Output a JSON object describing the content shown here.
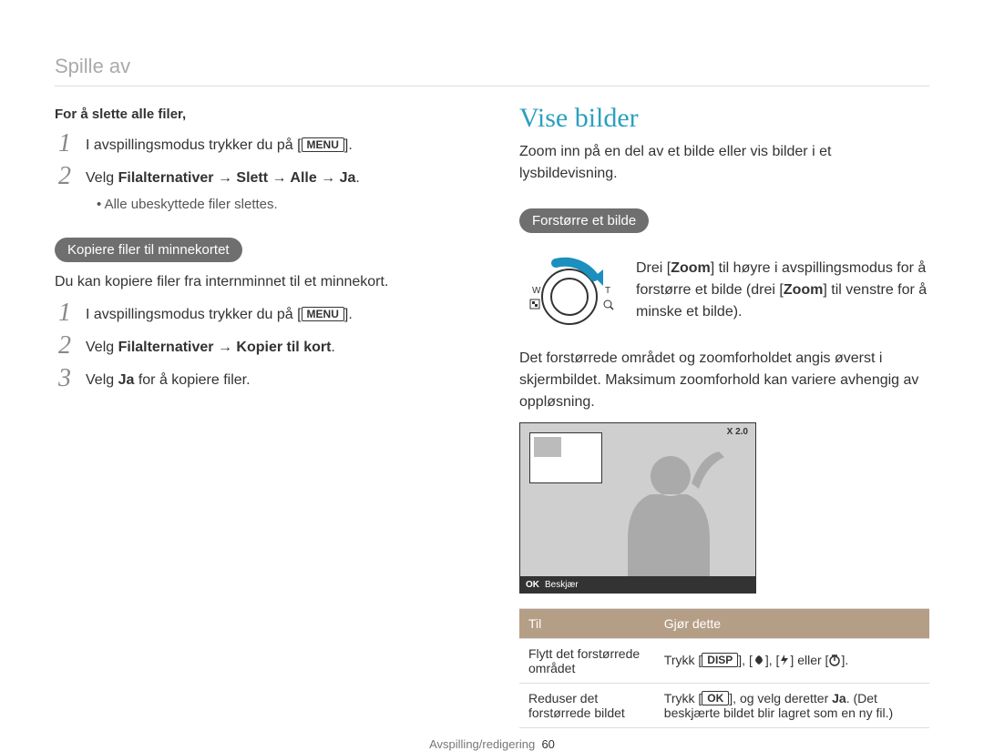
{
  "header": "Spille av",
  "left": {
    "delete_title": "For å slette alle filer,",
    "delete_steps": [
      {
        "num": "1",
        "pre": "I avspillingsmodus trykker du på [",
        "btn": "MENU",
        "post": "]."
      },
      {
        "num": "2",
        "pre": "Velg ",
        "bold": "Filalternativer → Slett → Alle → Ja",
        "post": "."
      }
    ],
    "delete_bullet": "Alle ubeskyttede filer slettes.",
    "copy_pill": "Kopiere filer til minnekortet",
    "copy_desc": "Du kan kopiere filer fra internminnet til et minnekort.",
    "copy_steps": [
      {
        "num": "1",
        "pre": "I avspillingsmodus trykker du på [",
        "btn": "MENU",
        "post": "]."
      },
      {
        "num": "2",
        "pre": "Velg ",
        "bold": "Filalternativer → Kopier til kort",
        "post": "."
      },
      {
        "num": "3",
        "pre": "Velg ",
        "bold": "Ja",
        "post": " for å kopiere filer."
      }
    ]
  },
  "right": {
    "title": "Vise bilder",
    "intro": "Zoom inn på en del av et bilde eller vis bilder i et lysbildevisning.",
    "enlarge_pill": "Forstørre et bilde",
    "zoom_text_parts": {
      "p1": "Drei [",
      "z1": "Zoom",
      "p2": "] til høyre i avspillingsmodus for å forstørre et bilde (drei [",
      "z2": "Zoom",
      "p3": "] til venstre for å minske et bilde)."
    },
    "zoom_note": "Det forstørrede området og zoomforholdet angis øverst i skjermbildet. Maksimum zoomforhold kan variere avhengig av oppløsning.",
    "zoom_label": "X 2.0",
    "zoom_ok": "Beskjær",
    "dial_labels": {
      "w": "W",
      "t": "T",
      "mag": ""
    },
    "table": {
      "h_to": "Til",
      "h_do": "Gjør dette",
      "r1_to": "Flytt det forstørrede området",
      "r1_do_pre": "Trykk [",
      "r1_btn": "DISP",
      "r1_do_mid": "], [",
      "r1_do_sep": "], [",
      "r1_do_or": "] eller [",
      "r1_do_post": "].",
      "r2_to": "Reduser det forstørrede bildet",
      "r2_do_pre": "Trykk [",
      "r2_btn": "OK",
      "r2_do_mid": "], og velg deretter ",
      "r2_bold": "Ja",
      "r2_do_post2": ". (Det beskjærte bildet blir lagret som en ny fil.)"
    }
  },
  "footer": {
    "label": "Avspilling/redigering",
    "page": "60"
  }
}
